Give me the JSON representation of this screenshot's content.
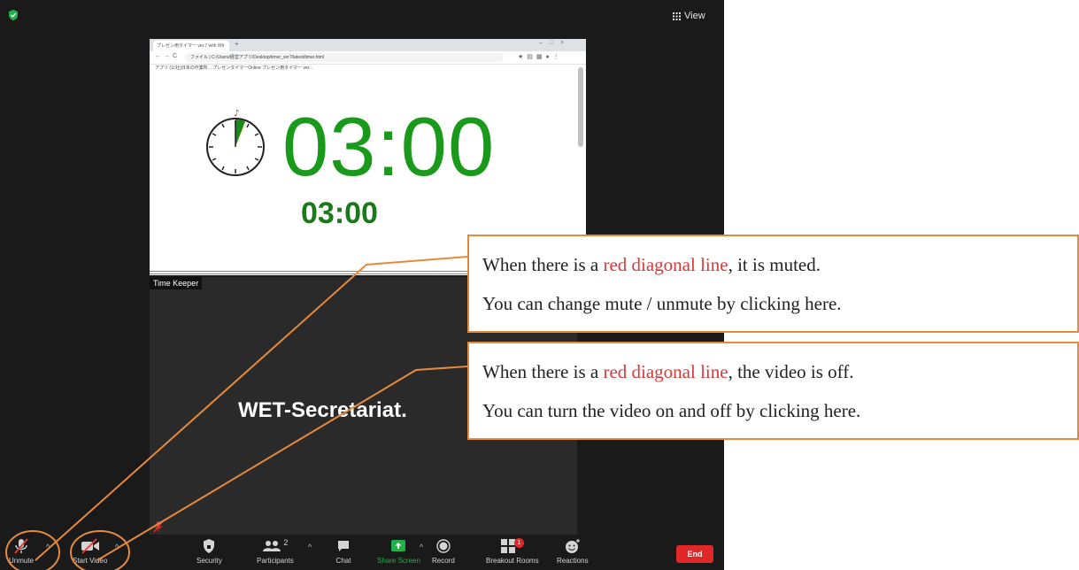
{
  "zoom": {
    "view_label": "View",
    "shared_screen": {
      "tab_title": "プレゼン用タイマー ver.7 with Wtr",
      "url": "ファイル | C:/Users/経営アプリ/Desktop/timer_ver7/latest/timer.html",
      "bookmarks": "アプリ   (公社)日本の作業所...   プレゼンタイマーOnline   プレゼン用タイマー ver...",
      "big_time": "03:00",
      "small_time": "03:00"
    },
    "tile_label": "Time Keeper",
    "participant_name": "WET-Secretariat.",
    "toolbar": {
      "unmute": "Unmute",
      "start_video": "Start Video",
      "security": "Security",
      "participants": "Participants",
      "participants_count": "2",
      "chat": "Chat",
      "share_screen": "Share Screen",
      "record": "Record",
      "breakout_rooms": "Breakout Rooms",
      "breakout_badge": "1",
      "reactions": "Reactions",
      "end": "End"
    }
  },
  "callouts": {
    "mute": {
      "line1_before": "When there is a ",
      "line1_red": "red diagonal line",
      "line1_after": ", it is muted.",
      "line2": "You can change mute / unmute by clicking here."
    },
    "video": {
      "line1_before": "When there is a ",
      "line1_red": "red diagonal line",
      "line1_after": ", the video is off.",
      "line2": "You can turn the video on and off by clicking here."
    }
  },
  "colors": {
    "annotation_orange": "#e58a3d",
    "timer_green": "#1a9a1a",
    "share_green": "#23b04b",
    "end_red": "#e02828",
    "mute_red": "#d63a3a"
  }
}
